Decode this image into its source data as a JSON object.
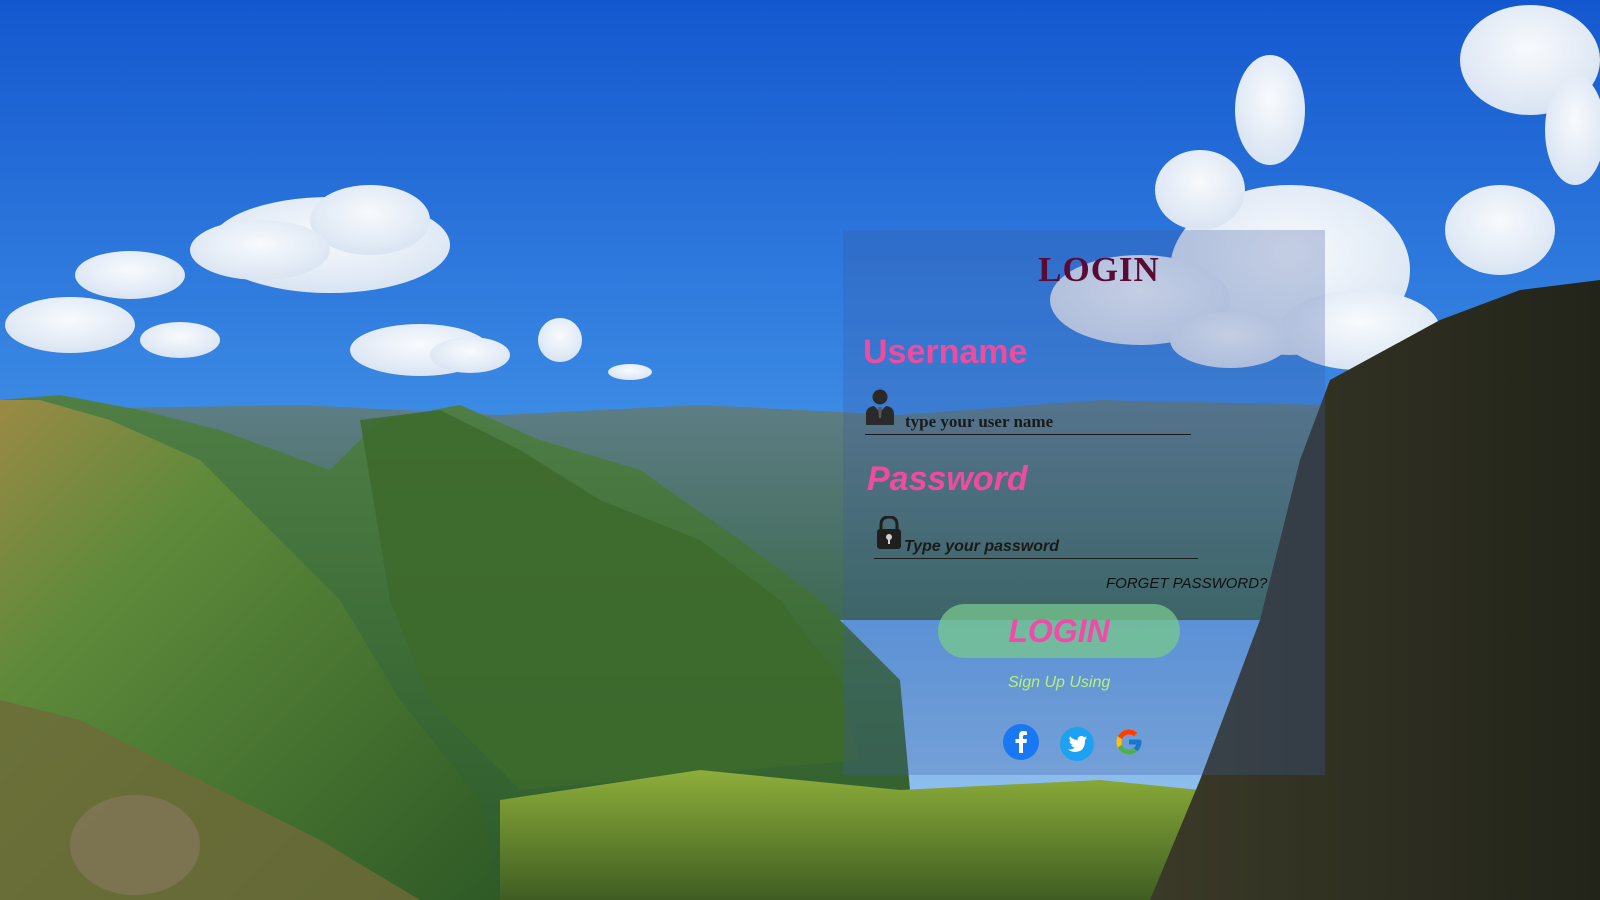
{
  "login_panel": {
    "title": "LOGIN",
    "username_label": "Username",
    "username_placeholder": "type your user name",
    "password_label": "Password",
    "password_placeholder": "Type your password",
    "forgot_label": "FORGET PASSWORD?",
    "login_button_label": "LOGIN",
    "signup_label": "Sign Up Using"
  },
  "icons": {
    "username": "user-icon",
    "password": "lock-icon",
    "social": [
      "facebook-icon",
      "twitter-icon",
      "google-icon"
    ]
  },
  "colors": {
    "label_pink": "#ee4c9e",
    "title_maroon": "#5a0a36",
    "button_green": "#78c88c",
    "signup_green": "#b7f07a",
    "facebook": "#1877f2",
    "twitter": "#1da1f2"
  }
}
